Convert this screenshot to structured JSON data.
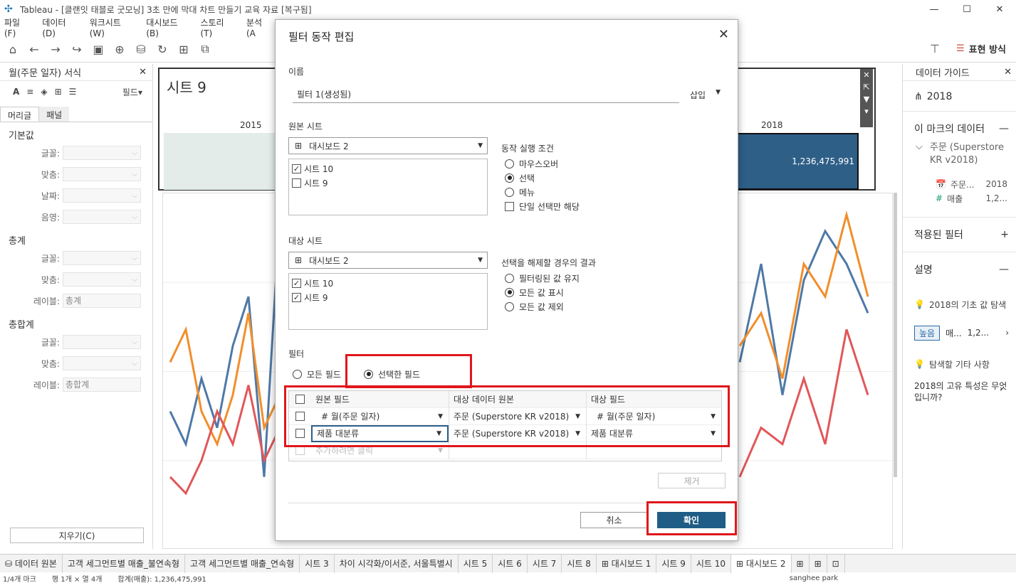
{
  "window": {
    "title": "Tableau - [클랜잇 태블로 굿모닝] 3초 만에 막대 차트 만들기 교육 자료 [복구됨]",
    "controls": [
      "—",
      "☐",
      "✕"
    ]
  },
  "menu": [
    "파일(F)",
    "데이터(D)",
    "워크시트(W)",
    "대시보드(B)",
    "스토리(T)",
    "분석(A"
  ],
  "toolbar": {
    "show_me_label": "표현 방식"
  },
  "left_pane": {
    "title": "월(주문 일자) 서식",
    "fields_label": "필드▾",
    "tabs": [
      "머리글",
      "패널"
    ],
    "sections": [
      {
        "title": "기본값",
        "rows": [
          {
            "label": "글꼴:",
            "value": ""
          },
          {
            "label": "맞춤:",
            "value": ""
          },
          {
            "label": "날짜:",
            "value": ""
          },
          {
            "label": "음영:",
            "value": ""
          }
        ]
      },
      {
        "title": "총계",
        "rows": [
          {
            "label": "글꼴:",
            "value": ""
          },
          {
            "label": "맞춤:",
            "value": ""
          },
          {
            "label": "레이블:",
            "value": "총계"
          }
        ]
      },
      {
        "title": "총합계",
        "rows": [
          {
            "label": "글꼴:",
            "value": ""
          },
          {
            "label": "맞춤:",
            "value": ""
          },
          {
            "label": "레이블:",
            "value": "총합계"
          }
        ]
      }
    ],
    "clear_button": "지우기(C)"
  },
  "canvas": {
    "sheet9_title": "시트 9",
    "year_left": "2015",
    "year_right": "2018",
    "bar_value": "1,236,475,991"
  },
  "chart_data": {
    "type": "line",
    "title": "",
    "series": [
      {
        "name": "",
        "color": "#4e79a7",
        "values": [
          40,
          30,
          50,
          35,
          60,
          75,
          20,
          100
        ]
      },
      {
        "name": "",
        "color": "#f28e2b",
        "values": [
          55,
          65,
          40,
          30,
          45,
          70,
          35,
          45
        ]
      },
      {
        "name": "",
        "color": "#e15759",
        "values": [
          20,
          15,
          25,
          40,
          30,
          48,
          25,
          35
        ]
      }
    ],
    "series_right": [
      {
        "name": "",
        "color": "#4e79a7",
        "values": [
          55,
          85,
          45,
          80,
          95,
          85,
          70
        ]
      },
      {
        "name": "",
        "color": "#f28e2b",
        "values": [
          60,
          70,
          50,
          85,
          75,
          100,
          75
        ]
      },
      {
        "name": "",
        "color": "#e15759",
        "values": [
          20,
          35,
          30,
          50,
          30,
          65,
          45
        ]
      }
    ]
  },
  "right_pane": {
    "title": "데이터 가이드",
    "year": "2018",
    "mark_data_title": "이 마크의 데이터",
    "source_name": "주문 (Superstore KR v2018)",
    "fields": [
      {
        "icon": "📅",
        "name": "주문...",
        "value": "2018"
      },
      {
        "icon": "#",
        "name": "매출",
        "value": "1,2..."
      }
    ],
    "applied_filters": "적용된 필터",
    "explanation": "설명",
    "explore_text": "2018의 기초 값 탐색",
    "high_badge": "높음",
    "high_field": "매...",
    "high_value": "1,2...",
    "other_text": "탐색할 기타 사항",
    "question": "2018의 고유 특성은 무엇입니까?"
  },
  "dialog": {
    "title": "필터 동작 편집",
    "name_label": "이름",
    "name_value": "필터 1(생성됨)",
    "insert_label": "삽입",
    "source_label": "원본 시트",
    "source_combo": "대시보드 2",
    "source_sheets": [
      {
        "label": "시트 10",
        "checked": true
      },
      {
        "label": "시트 9",
        "checked": false
      }
    ],
    "run_on_label": "동작 실행 조건",
    "run_on_options": [
      {
        "label": "마우스오버",
        "selected": false
      },
      {
        "label": "선택",
        "selected": true
      },
      {
        "label": "메뉴",
        "selected": false
      }
    ],
    "single_select_label": "단일 선택만 해당",
    "target_label": "대상 시트",
    "target_combo": "대시보드 2",
    "target_sheets": [
      {
        "label": "시트 10",
        "checked": true
      },
      {
        "label": "시트 9",
        "checked": true
      }
    ],
    "clear_label": "선택을 해제할 경우의 결과",
    "clear_options": [
      {
        "label": "필터링된 값 유지",
        "selected": false
      },
      {
        "label": "모든 값 표시",
        "selected": true
      },
      {
        "label": "모든 값 제외",
        "selected": false
      }
    ],
    "filter_label": "필터",
    "filter_all": "모든 필드",
    "filter_selected": "선택한 필드",
    "grid_headers": [
      "원본 필드",
      "대상 데이터 원본",
      "대상 필드"
    ],
    "grid_rows": [
      {
        "source": "# 월(주문 일자)",
        "datasource": "주문 (Superstore KR v2018)",
        "target": "# 월(주문 일자)"
      },
      {
        "source": "제품 대분류",
        "datasource": "주문 (Superstore KR v2018)",
        "target": "제품 대분류"
      }
    ],
    "grid_add_placeholder": "추가하려면 클릭",
    "remove_button": "제거",
    "cancel_button": "취소",
    "ok_button": "확인"
  },
  "bottom_tabs": [
    "데이터 원본",
    "고객 세그먼트별 매출_불연속형",
    "고객 세그먼트별 매출_연속형",
    "시트 3",
    "차이 시각화/이서준, 서울특별시",
    "시트 5",
    "시트 6",
    "시트 7",
    "시트 8",
    "대시보드 1",
    "시트 9",
    "시트 10",
    "대시보드 2"
  ],
  "status": {
    "marks": "1/4개 마크",
    "rows_cols": "행 1개 × 열 4개",
    "sum": "합계(매출): 1,236,475,991",
    "user": "sanghee park"
  }
}
